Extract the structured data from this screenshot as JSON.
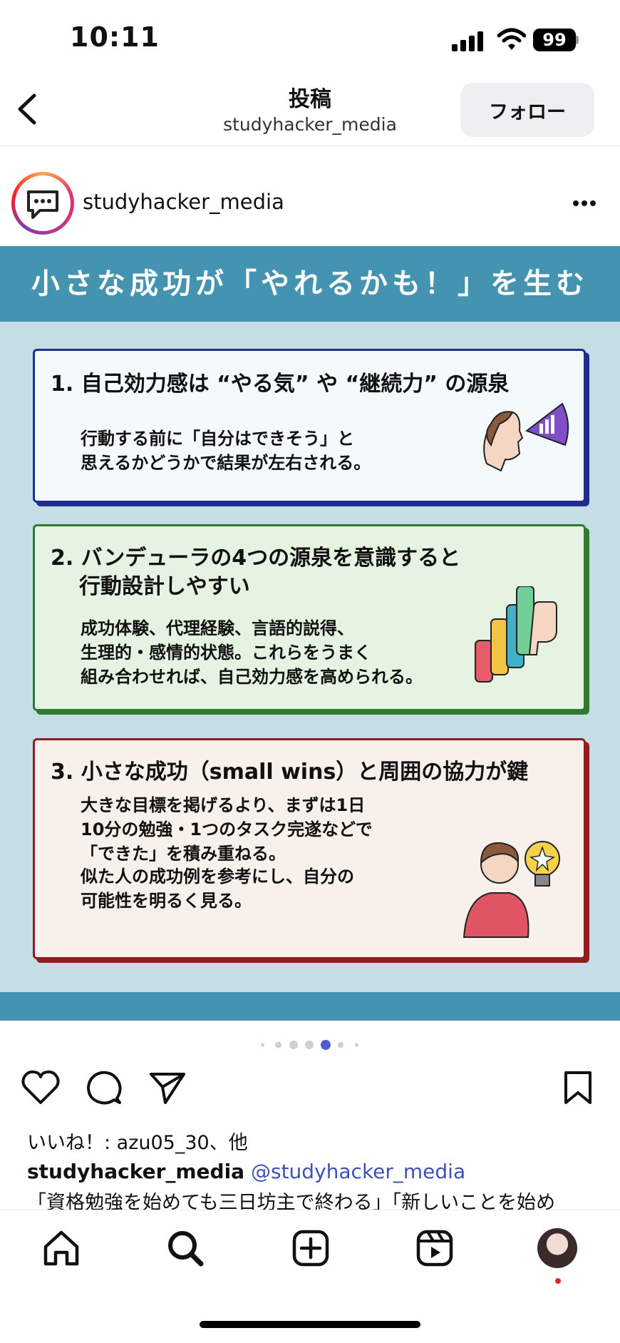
{
  "status_bar": {
    "time": "10:11",
    "battery": "99"
  },
  "header": {
    "title": "投稿",
    "subtitle": "studyhacker_media",
    "follow_label": "フォロー"
  },
  "post": {
    "username": "studyhacker_media"
  },
  "card": {
    "banner": "小さな成功が「やれるかも！」を生む",
    "items": [
      {
        "heading": "1. 自己効力感は “やる気” や “継続力” の源泉",
        "body": "行動する前に「自分はできそう」と\n思えるかどうかで結果が左右される。"
      },
      {
        "heading_line1": "2. バンデューラの4つの源泉を意識すると",
        "heading_line2": "行動設計しやすい",
        "body": "成功体験、代理経験、言語的説得、\n生理的・感情的状態。これらをうまく\n組み合わせれば、自己効力感を高められる。"
      },
      {
        "heading": "3. 小さな成功（small wins）と周囲の協力が鍵",
        "body1": "大きな目標を掲げるより、まずは1日\n10分の勉強・1つのタスク完遂などで\n「できた」を積み重ねる。",
        "body2": "似た人の成功例を参考にし、自分の\n可能性を明るく見る。"
      }
    ]
  },
  "carousel": {
    "count": 7,
    "active_index": 4
  },
  "likes": "いいね！: azu05_30、他",
  "caption": {
    "user": "studyhacker_media",
    "mention": "@studyhacker_media",
    "text": "「資格勉強を始めても三日坊主で終わる」「新しいことを始め"
  },
  "colors": {
    "banner": "#4494b1",
    "card_bg": "#c5dde4",
    "accent_dot": "#4f5bd5",
    "mention": "#3f51b5"
  }
}
